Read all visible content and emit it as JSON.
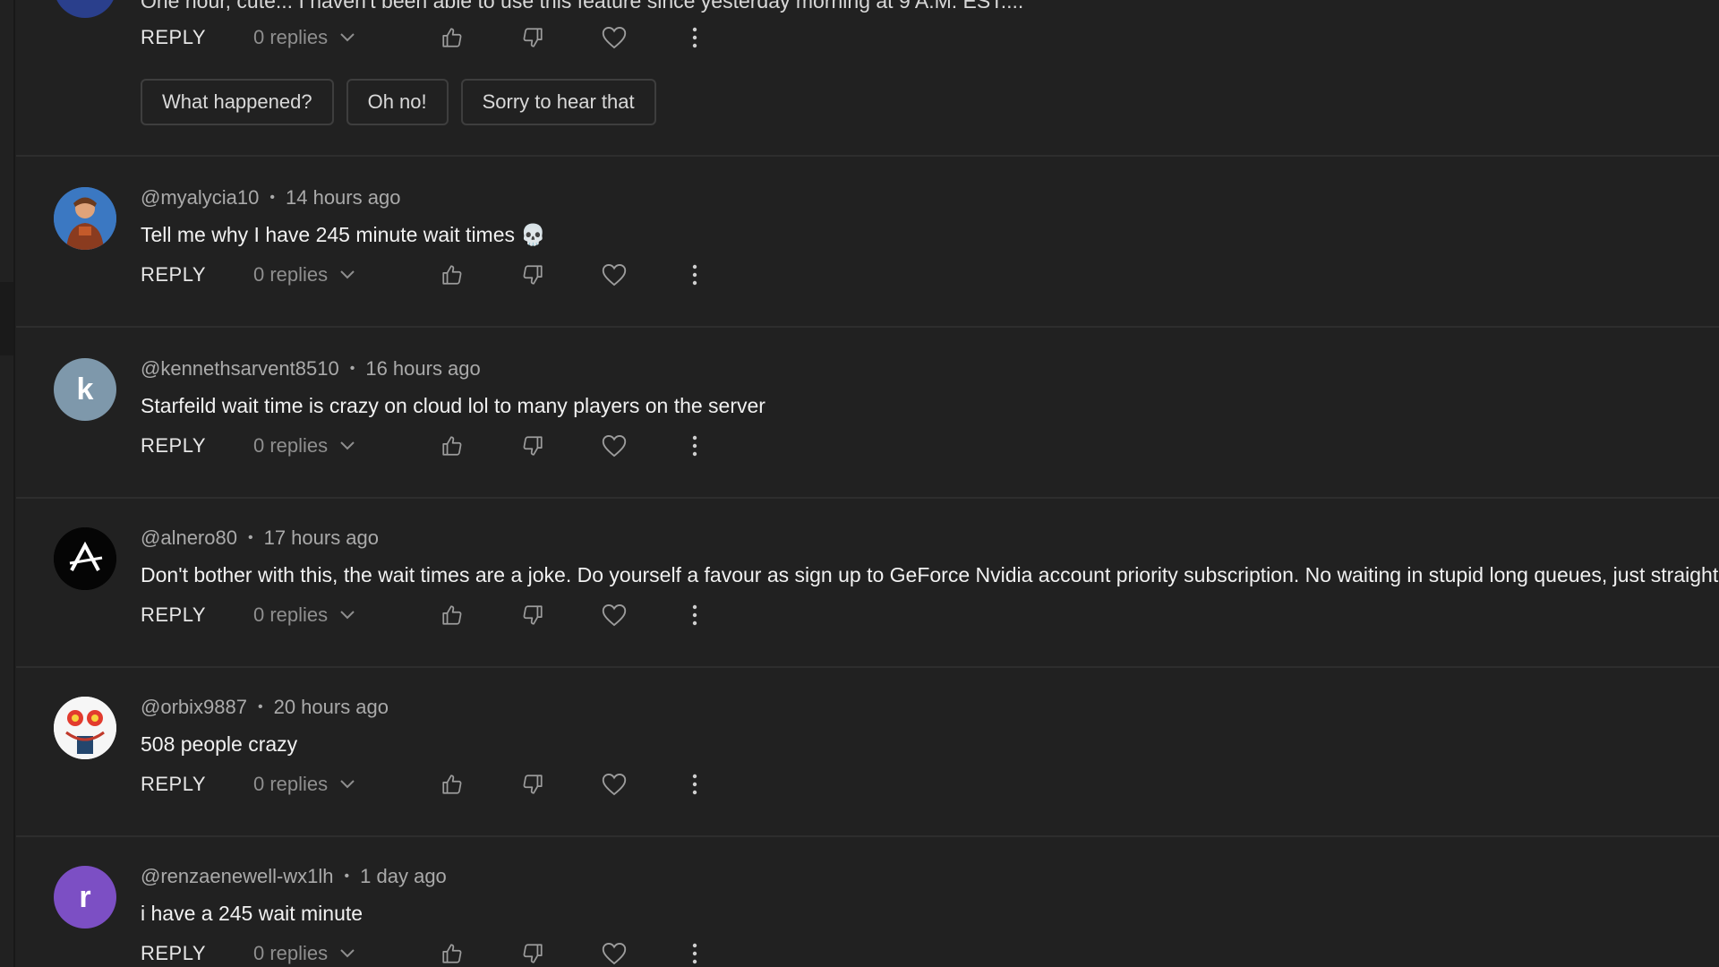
{
  "top_comment": {
    "text": "One hour, cute... I haven't been able to use this feature since yesterday morning at 9 A.M. EST....",
    "reply_label": "REPLY",
    "replies_label": "0 replies",
    "suggested_replies": [
      "What happened?",
      "Oh no!",
      "Sorry to hear that"
    ]
  },
  "comments": [
    {
      "handle": "@myalycia10",
      "time": "14 hours ago",
      "text": "Tell me why I have 245 minute wait times 💀",
      "reply_label": "REPLY",
      "replies_label": "0 replies",
      "avatar": {
        "type": "image",
        "letter": "",
        "color": "#3a6fb0"
      }
    },
    {
      "handle": "@kennethsarvent8510",
      "time": "16 hours ago",
      "text": "Starfeild wait time is crazy on cloud lol to many players on the server",
      "reply_label": "REPLY",
      "replies_label": "0 replies",
      "avatar": {
        "type": "letter",
        "letter": "k",
        "color": "#7e98ab"
      }
    },
    {
      "handle": "@alnero80",
      "time": "17 hours ago",
      "text": "Don't bother with this, the wait times are a joke. Do yourself a favour as sign up to GeForce Nvidia account priority subscription. No waiting in stupid long queues, just straight in a",
      "reply_label": "REPLY",
      "replies_label": "0 replies",
      "avatar": {
        "type": "logo",
        "letter": "",
        "color": "#000000"
      }
    },
    {
      "handle": "@orbix9887",
      "time": "20 hours ago",
      "text": "508 people crazy",
      "reply_label": "REPLY",
      "replies_label": "0 replies",
      "avatar": {
        "type": "image",
        "letter": "",
        "color": "#f4f4f4"
      }
    },
    {
      "handle": "@renzaenewell-wx1lh",
      "time": "1 day ago",
      "text": "i have a 245 wait minute",
      "reply_label": "REPLY",
      "replies_label": "0 replies",
      "avatar": {
        "type": "letter",
        "letter": "r",
        "color": "#7c4fc4"
      }
    }
  ],
  "colors": {
    "background": "#212121",
    "text_primary": "#f1f1f1",
    "text_secondary": "#aaaaaa",
    "divider": "#2d2d2d"
  },
  "icons": [
    "thumb-up-icon",
    "thumb-down-icon",
    "heart-icon",
    "more-vert-icon",
    "chevron-down-icon"
  ]
}
